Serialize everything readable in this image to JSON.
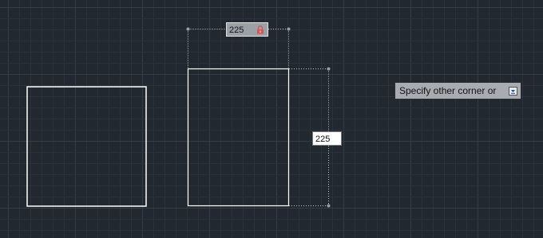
{
  "drawing": {
    "width_input_value": "225",
    "height_input_value": "225",
    "command_prompt": "Specify other corner or"
  },
  "icons": {
    "width_lock": "lock-icon",
    "prompt_options": "chevron-down-icon"
  },
  "colors": {
    "background": "#212830",
    "grid_minor": "#2b323b",
    "grid_major": "#343c46",
    "geometry": "#ffffff",
    "lock": "#d9534f"
  }
}
